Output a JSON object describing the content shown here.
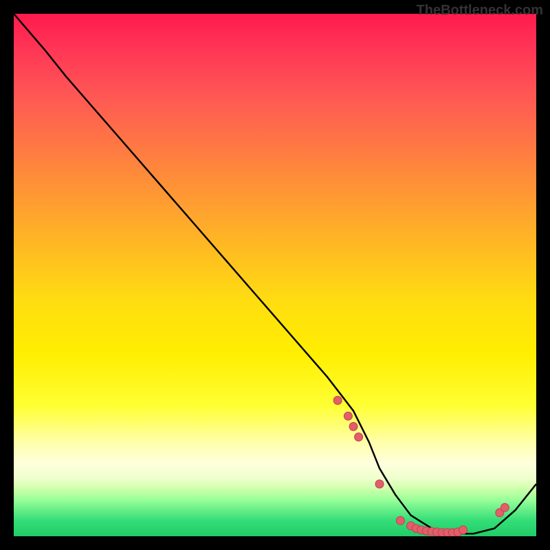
{
  "watermark": "TheBottleneck.com",
  "chart_data": {
    "type": "line",
    "title": "",
    "xlabel": "",
    "ylabel": "",
    "xlim": [
      0,
      100
    ],
    "ylim": [
      0,
      100
    ],
    "curve": {
      "x": [
        0,
        6,
        10,
        20,
        30,
        40,
        50,
        60,
        65,
        68,
        70,
        73,
        76,
        80,
        84,
        88,
        92,
        96,
        100
      ],
      "y": [
        100,
        93,
        88,
        76.5,
        65,
        53.5,
        42,
        30.5,
        24,
        18,
        13,
        8,
        4,
        1.5,
        0.5,
        0.5,
        1.5,
        5,
        10
      ]
    },
    "dots": [
      {
        "x": 62,
        "y": 26,
        "r": 6
      },
      {
        "x": 64,
        "y": 23,
        "r": 6
      },
      {
        "x": 65,
        "y": 21,
        "r": 6
      },
      {
        "x": 66,
        "y": 19,
        "r": 6
      },
      {
        "x": 70,
        "y": 10,
        "r": 6
      },
      {
        "x": 74,
        "y": 3,
        "r": 6
      },
      {
        "x": 76,
        "y": 2,
        "r": 6
      },
      {
        "x": 77,
        "y": 1.5,
        "r": 6
      },
      {
        "x": 78,
        "y": 1.2,
        "r": 6
      },
      {
        "x": 79,
        "y": 1,
        "r": 6
      },
      {
        "x": 80,
        "y": 0.9,
        "r": 6
      },
      {
        "x": 81,
        "y": 0.8,
        "r": 6
      },
      {
        "x": 82,
        "y": 0.7,
        "r": 6
      },
      {
        "x": 83,
        "y": 0.7,
        "r": 6
      },
      {
        "x": 84,
        "y": 0.7,
        "r": 6
      },
      {
        "x": 85,
        "y": 0.8,
        "r": 6
      },
      {
        "x": 86,
        "y": 1.2,
        "r": 6
      },
      {
        "x": 93,
        "y": 4.5,
        "r": 6
      },
      {
        "x": 94,
        "y": 5.5,
        "r": 6
      }
    ],
    "colors": {
      "curve": "#000000",
      "dot_fill": "#e35d6a",
      "dot_stroke": "#c04050",
      "gradient_top": "#ff1a4d",
      "gradient_bottom": "#22cc66"
    }
  }
}
